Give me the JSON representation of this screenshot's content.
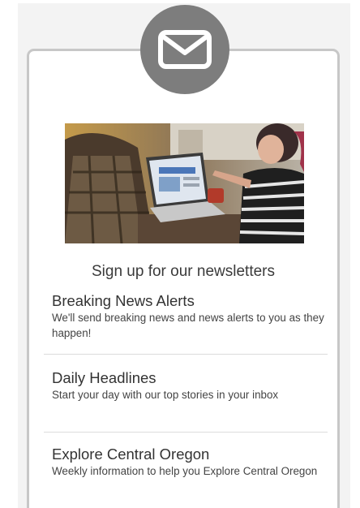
{
  "signup": {
    "title": "Sign up for our newsletters"
  },
  "icon": {
    "badge": "envelope-icon",
    "badge_color": "#7d7d7d"
  },
  "newsletters": [
    {
      "name": "Breaking News Alerts",
      "description": "We'll send breaking news and news alerts to you as they happen!"
    },
    {
      "name": "Daily Headlines",
      "description": "Start your day with our top stories in your inbox"
    },
    {
      "name": "Explore Central Oregon",
      "description": "Weekly information to help you Explore Central Oregon"
    }
  ]
}
